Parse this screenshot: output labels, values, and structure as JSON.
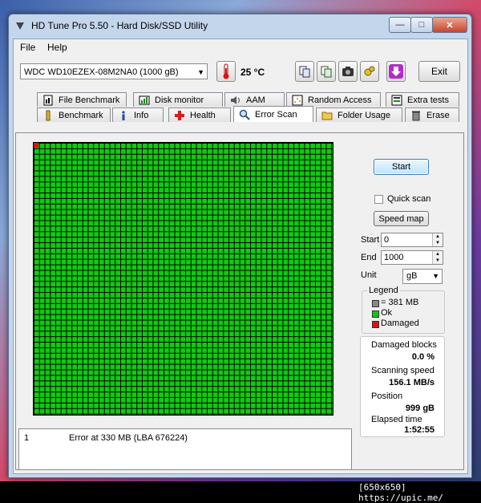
{
  "window": {
    "title": "HD Tune Pro 5.50 - Hard Disk/SSD Utility"
  },
  "menu": {
    "file": "File",
    "help": "Help"
  },
  "toolbar": {
    "drive": "WDC WD10EZEX-08M2NA0 (1000 gB)",
    "temperature": "25 °C",
    "exit_label": "Exit"
  },
  "tabs": {
    "row1": [
      "File Benchmark",
      "Disk monitor",
      "AAM",
      "Random Access",
      "Extra tests"
    ],
    "row2": [
      "Benchmark",
      "Info",
      "Health",
      "Error Scan",
      "Folder Usage",
      "Erase"
    ],
    "active": "Error Scan"
  },
  "controls": {
    "start_label": "Start",
    "quick_scan_label": "Quick scan",
    "speed_map_label": "Speed map",
    "start_field_label": "Start",
    "start_value": "0",
    "end_field_label": "End",
    "end_value": "1000",
    "unit_label": "Unit",
    "unit_value": "gB"
  },
  "legend": {
    "title": "Legend",
    "block_size": "= 381 MB",
    "ok": "Ok",
    "damaged": "Damaged",
    "colors": {
      "ok": "#11c911",
      "damaged": "#e01010"
    }
  },
  "stats": {
    "damaged_blocks_label": "Damaged blocks",
    "damaged_blocks_value": "0.0 %",
    "scanning_speed_label": "Scanning speed",
    "scanning_speed_value": "156.1 MB/s",
    "position_label": "Position",
    "position_value": "999 gB",
    "elapsed_label": "Elapsed time",
    "elapsed_value": "1:52:55"
  },
  "log": [
    {
      "index": "1",
      "message": "Error at 330 MB (LBA 676224)"
    }
  ],
  "footer": "[650x650] https://upic.me/"
}
